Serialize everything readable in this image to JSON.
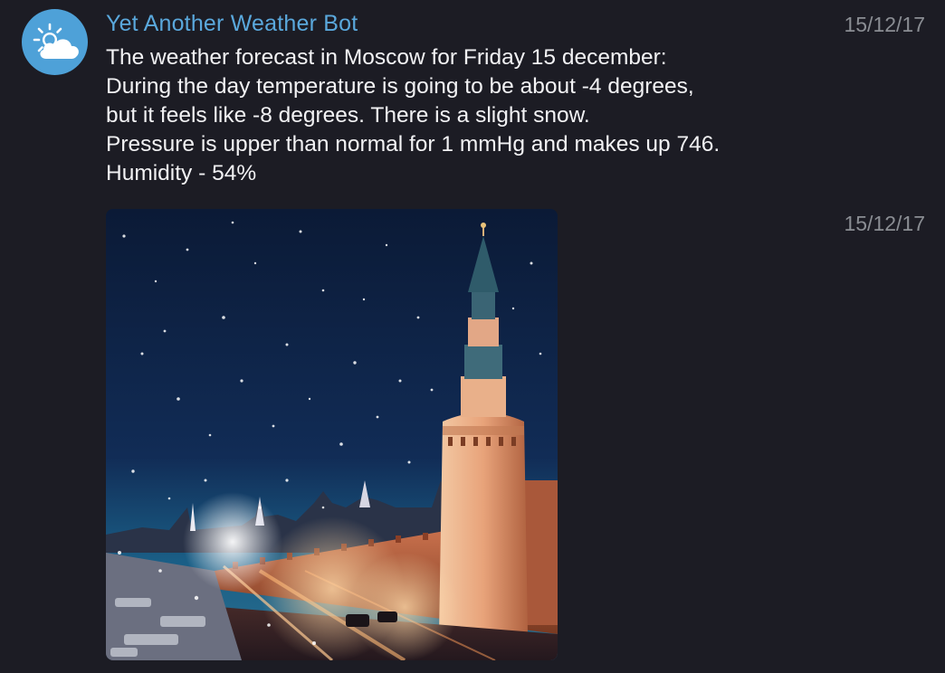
{
  "message1": {
    "avatar_icon": "partly-cloudy-icon",
    "sender": "Yet Another Weather Bot",
    "time": "15/12/17",
    "lines": [
      "The weather forecast in Moscow for Friday 15 december:",
      "During the day temperature is going to be about -4 degrees,",
      "but it feels like -8 degrees. There is a slight snow.",
      "Pressure is upper than normal for 1 mmHg and makes up 746.",
      "Humidity - 54%"
    ]
  },
  "message2": {
    "time": "15/12/17",
    "photo_subject": "Kremlin tower at night in snowfall"
  },
  "colors": {
    "background": "#1c1c24",
    "sender": "#5aa8dc",
    "text": "#f2f2f4",
    "time": "#8a8d93",
    "avatar": "#4ea1d8"
  }
}
